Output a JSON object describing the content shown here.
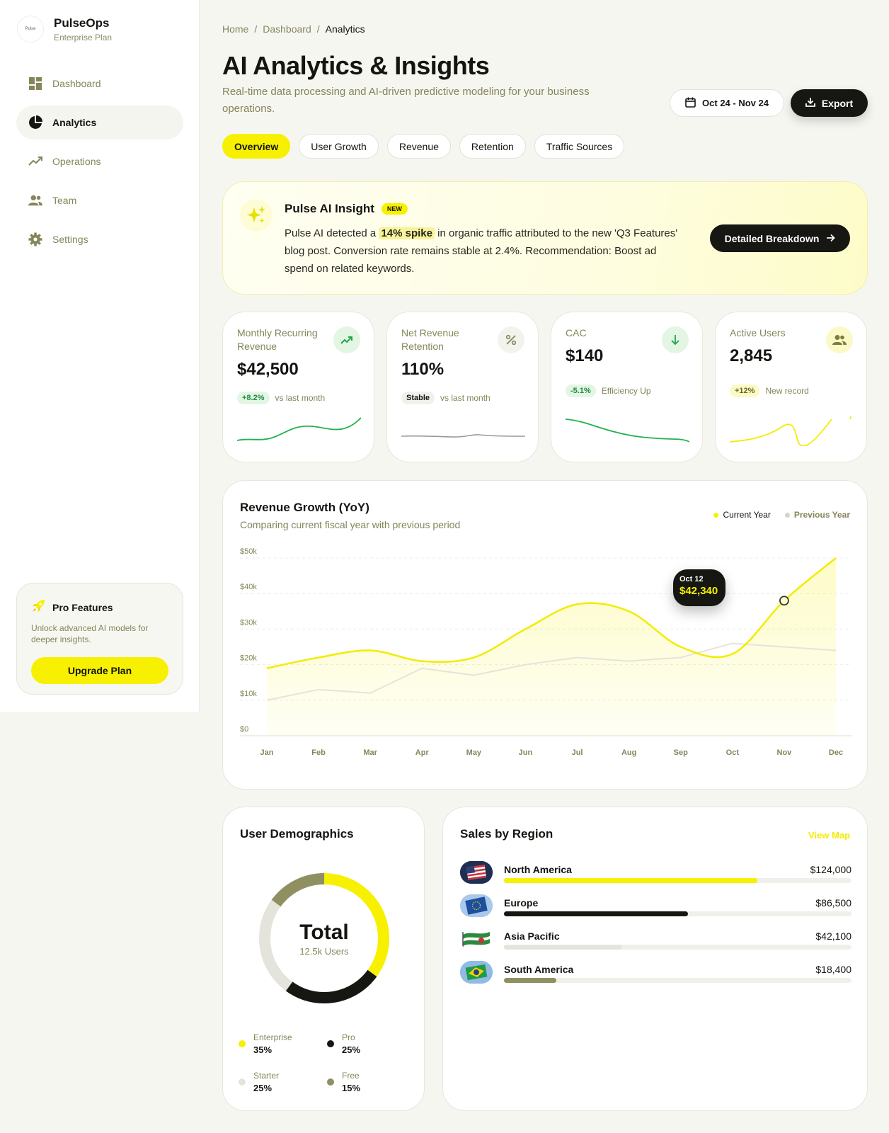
{
  "brand": {
    "name": "PulseOps",
    "plan": "Enterprise Plan",
    "logo_text": "Pulse"
  },
  "nav": [
    {
      "label": "Dashboard",
      "icon": "dashboard-icon"
    },
    {
      "label": "Analytics",
      "icon": "pie-icon",
      "active": true
    },
    {
      "label": "Operations",
      "icon": "trend-icon"
    },
    {
      "label": "Team",
      "icon": "team-icon"
    },
    {
      "label": "Settings",
      "icon": "gear-icon"
    }
  ],
  "promo": {
    "title": "Pro Features",
    "desc": "Unlock advanced AI models for deeper insights.",
    "button": "Upgrade Plan"
  },
  "breadcrumb": [
    "Home",
    "Dashboard",
    "Analytics"
  ],
  "page": {
    "title": "AI Analytics & Insights",
    "subtitle": "Real-time data processing and AI-driven predictive modeling for your business operations.",
    "date_range": "Oct 24 - Nov 24",
    "export": "Export"
  },
  "tabs": [
    "Overview",
    "User Growth",
    "Revenue",
    "Retention",
    "Traffic Sources"
  ],
  "insight": {
    "title": "Pulse AI Insight",
    "badge": "NEW",
    "text_pre": "Pulse AI detected a ",
    "highlight": "14% spike",
    "text_post": " in organic traffic attributed to the new 'Q3 Features' blog post. Conversion rate remains stable at 2.4%. Recommendation: Boost ad spend on related keywords.",
    "button": "Detailed Breakdown"
  },
  "kpis": [
    {
      "label": "Monthly Recurring Revenue",
      "value": "$42,500",
      "pill": "+8.2%",
      "note": "vs last month",
      "icon": "trending-up-icon"
    },
    {
      "label": "Net Revenue Retention",
      "value": "110%",
      "pill": "Stable",
      "note": "vs last month",
      "icon": "percent-icon"
    },
    {
      "label": "CAC",
      "value": "$140",
      "pill": "-5.1%",
      "note": "Efficiency Up",
      "icon": "arrow-down-icon"
    },
    {
      "label": "Active Users",
      "value": "2,845",
      "pill": "+12%",
      "note": "New record",
      "icon": "users-icon"
    }
  ],
  "colors": {
    "accent": "#f7f000",
    "dark": "#161612",
    "muted": "#85855a",
    "green": "#22b14c",
    "olive": "#8f8f62"
  },
  "revenue": {
    "title": "Revenue Growth (YoY)",
    "subtitle": "Comparing current fiscal year with previous period",
    "tooltip": {
      "date": "Oct 12",
      "value": "$42,340"
    }
  },
  "chart_data": {
    "type": "area",
    "categories": [
      "Jan",
      "Feb",
      "Mar",
      "Apr",
      "May",
      "Jun",
      "Jul",
      "Aug",
      "Sep",
      "Oct",
      "Nov",
      "Dec"
    ],
    "yticks": [
      "$0",
      "$10k",
      "$20k",
      "$30k",
      "$40k",
      "$50k"
    ],
    "ylim": [
      0,
      50
    ],
    "grid": true,
    "legend_position": "top-right",
    "series": [
      {
        "name": "Current Year",
        "values": [
          19,
          22,
          24,
          21,
          22,
          30,
          37,
          35,
          25,
          23,
          38,
          50
        ]
      },
      {
        "name": "Previous Year",
        "values": [
          10,
          13,
          12,
          19,
          17,
          20,
          22,
          21,
          22,
          26,
          25,
          24
        ]
      }
    ]
  },
  "demographics": {
    "title": "User Demographics",
    "total": "Total",
    "users": "12.5k Users",
    "segments": [
      {
        "label": "Enterprise",
        "value": "35%",
        "pct": 35,
        "color": "#f7f000"
      },
      {
        "label": "Pro",
        "value": "25%",
        "pct": 25,
        "color": "#161612"
      },
      {
        "label": "Starter",
        "value": "25%",
        "pct": 25,
        "color": "#e4e4dc"
      },
      {
        "label": "Free",
        "value": "15%",
        "pct": 15,
        "color": "#8f8f62"
      }
    ]
  },
  "sales": {
    "title": "Sales by Region",
    "link": "View Map",
    "regions": [
      {
        "name": "North America",
        "value": "$124,000",
        "fraction": 0.73,
        "color": "#f7f000",
        "flag": "usa-flag-icon"
      },
      {
        "name": "Europe",
        "value": "$86,500",
        "fraction": 0.53,
        "color": "#161612",
        "flag": "eu-flag-icon"
      },
      {
        "name": "Asia Pacific",
        "value": "$42,100",
        "fraction": 0.34,
        "color": "#e4e4dc",
        "flag": "apac-flag-icon"
      },
      {
        "name": "South America",
        "value": "$18,400",
        "fraction": 0.15,
        "color": "#8f8f62",
        "flag": "brazil-flag-icon"
      }
    ]
  }
}
